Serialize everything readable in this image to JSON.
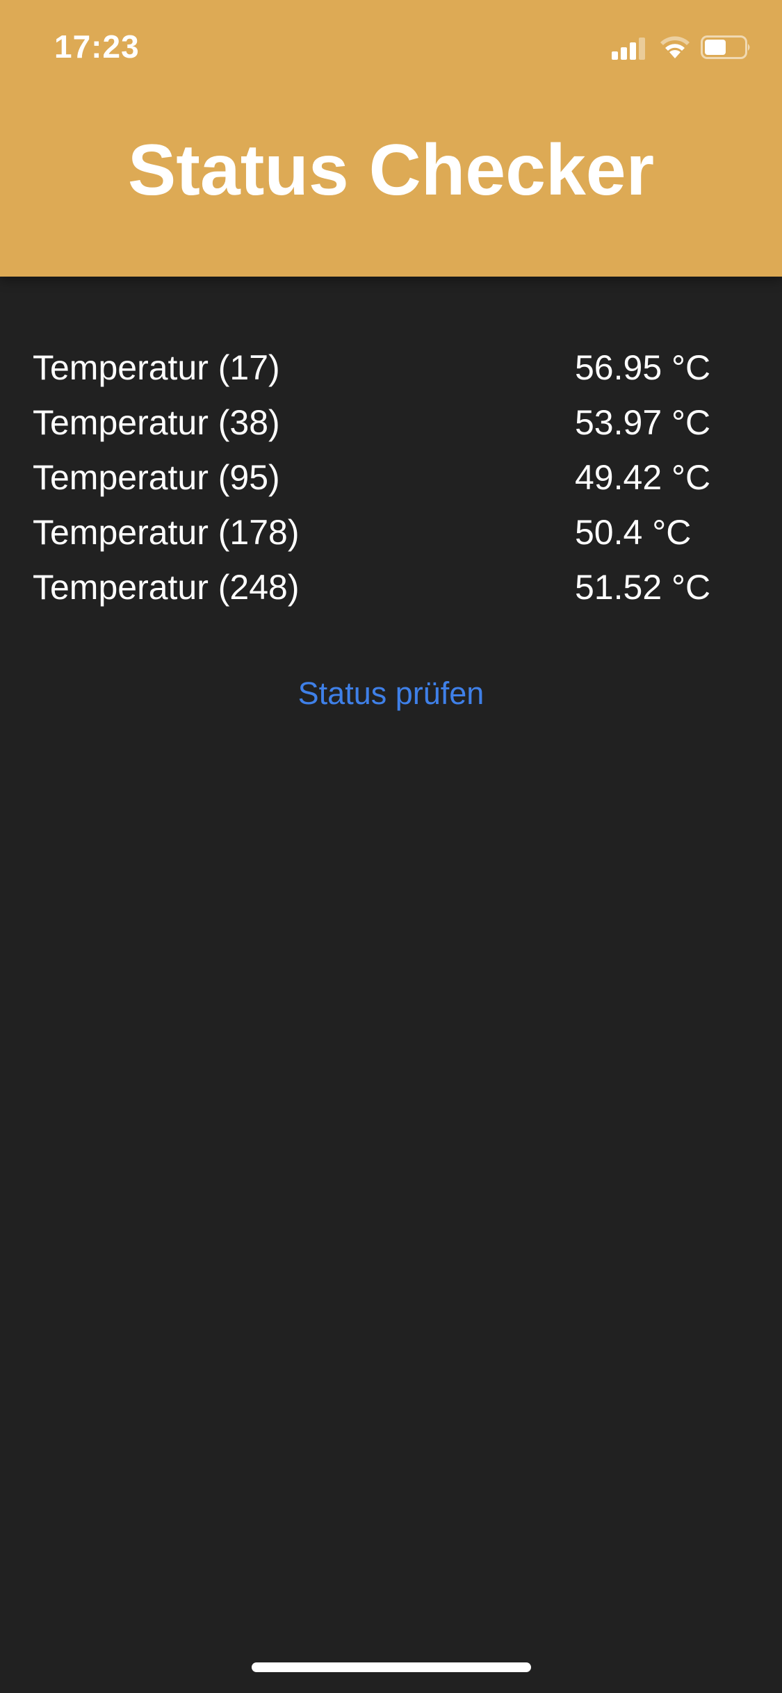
{
  "status_bar": {
    "time": "17:23",
    "icons": [
      "signal-icon",
      "wifi-icon",
      "battery-icon"
    ]
  },
  "header": {
    "title": "Status Checker",
    "background_color": "#ddaa55"
  },
  "readings": [
    {
      "label": "Temperatur (17)",
      "value": "56.95 °C"
    },
    {
      "label": "Temperatur (38)",
      "value": "53.97 °C"
    },
    {
      "label": "Temperatur (95)",
      "value": "49.42 °C"
    },
    {
      "label": "Temperatur (178)",
      "value": "50.4 °C"
    },
    {
      "label": "Temperatur (248)",
      "value": "51.52 °C"
    }
  ],
  "actions": {
    "check_status_label": "Status prüfen",
    "link_color": "#3f80e8"
  },
  "theme": {
    "background": "#212121",
    "text": "#ffffff"
  }
}
